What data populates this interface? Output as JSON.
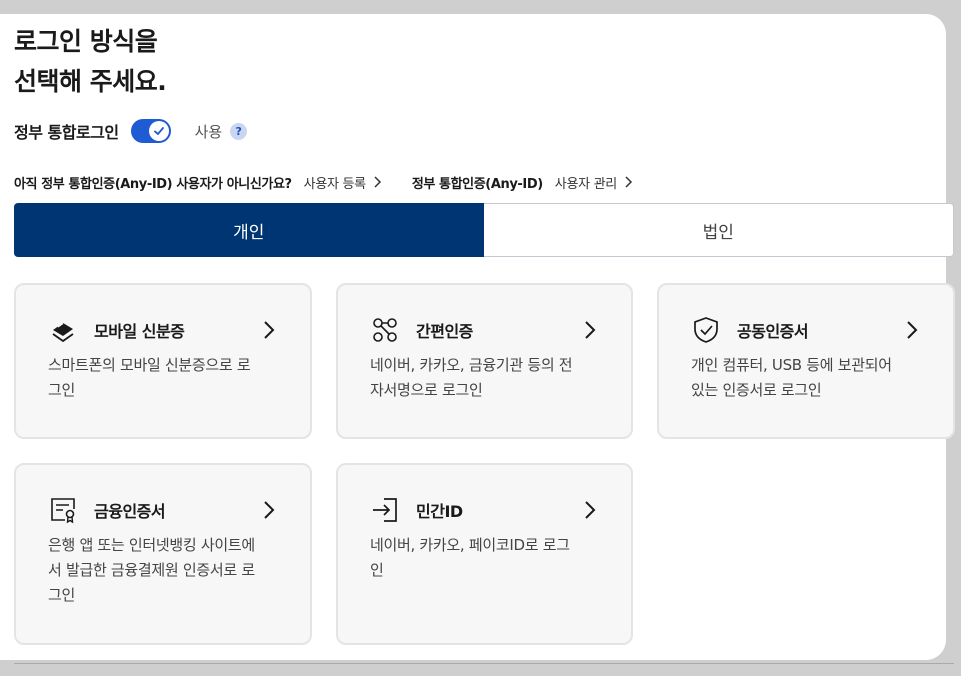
{
  "header": {
    "title_line1": "로그인 방식을",
    "title_line2": "선택해 주세요."
  },
  "gov_login": {
    "label": "정부 통합로그인",
    "toggle_on": true,
    "use_label": "사용",
    "help": "?"
  },
  "anyid": {
    "question": "아직 정부 통합인증(Any-ID) 사용자가 아니신가요?",
    "register_link": "사용자 등록",
    "manage_label": "정부 통합인증(Any-ID)",
    "manage_link": "사용자 관리"
  },
  "tabs": [
    {
      "label": "개인",
      "active": true
    },
    {
      "label": "법인",
      "active": false
    }
  ],
  "cards": [
    {
      "icon": "mobile-id-icon",
      "title": "모바일 신분증",
      "desc_lines": [
        "스마트폰의 모바일 신분증으로 로",
        "그인"
      ]
    },
    {
      "icon": "simple-auth-icon",
      "title": "간편인증",
      "desc_lines": [
        "네이버, 카카오, 금융기관 등의 전",
        "자서명으로 로그인"
      ]
    },
    {
      "icon": "shield-check-icon",
      "title": "공동인증서",
      "desc_lines": [
        "개인 컴퓨터, USB 등에 보관되어",
        "있는 인증서로 로그인"
      ]
    },
    {
      "icon": "certificate-icon",
      "title": "금융인증서",
      "desc_lines": [
        "은행 앱 또는 인터넷뱅킹 사이트에",
        "서 발급한 금융결제원 인증서로 로",
        "그인"
      ]
    },
    {
      "icon": "login-arrow-icon",
      "title": "민간ID",
      "desc_lines": [
        "네이버, 카카오, 페이코ID로 로그",
        "인"
      ]
    }
  ],
  "colors": {
    "primary": "#003574",
    "toggle": "#1f5bd3",
    "card_bg": "#f7f7f7"
  }
}
